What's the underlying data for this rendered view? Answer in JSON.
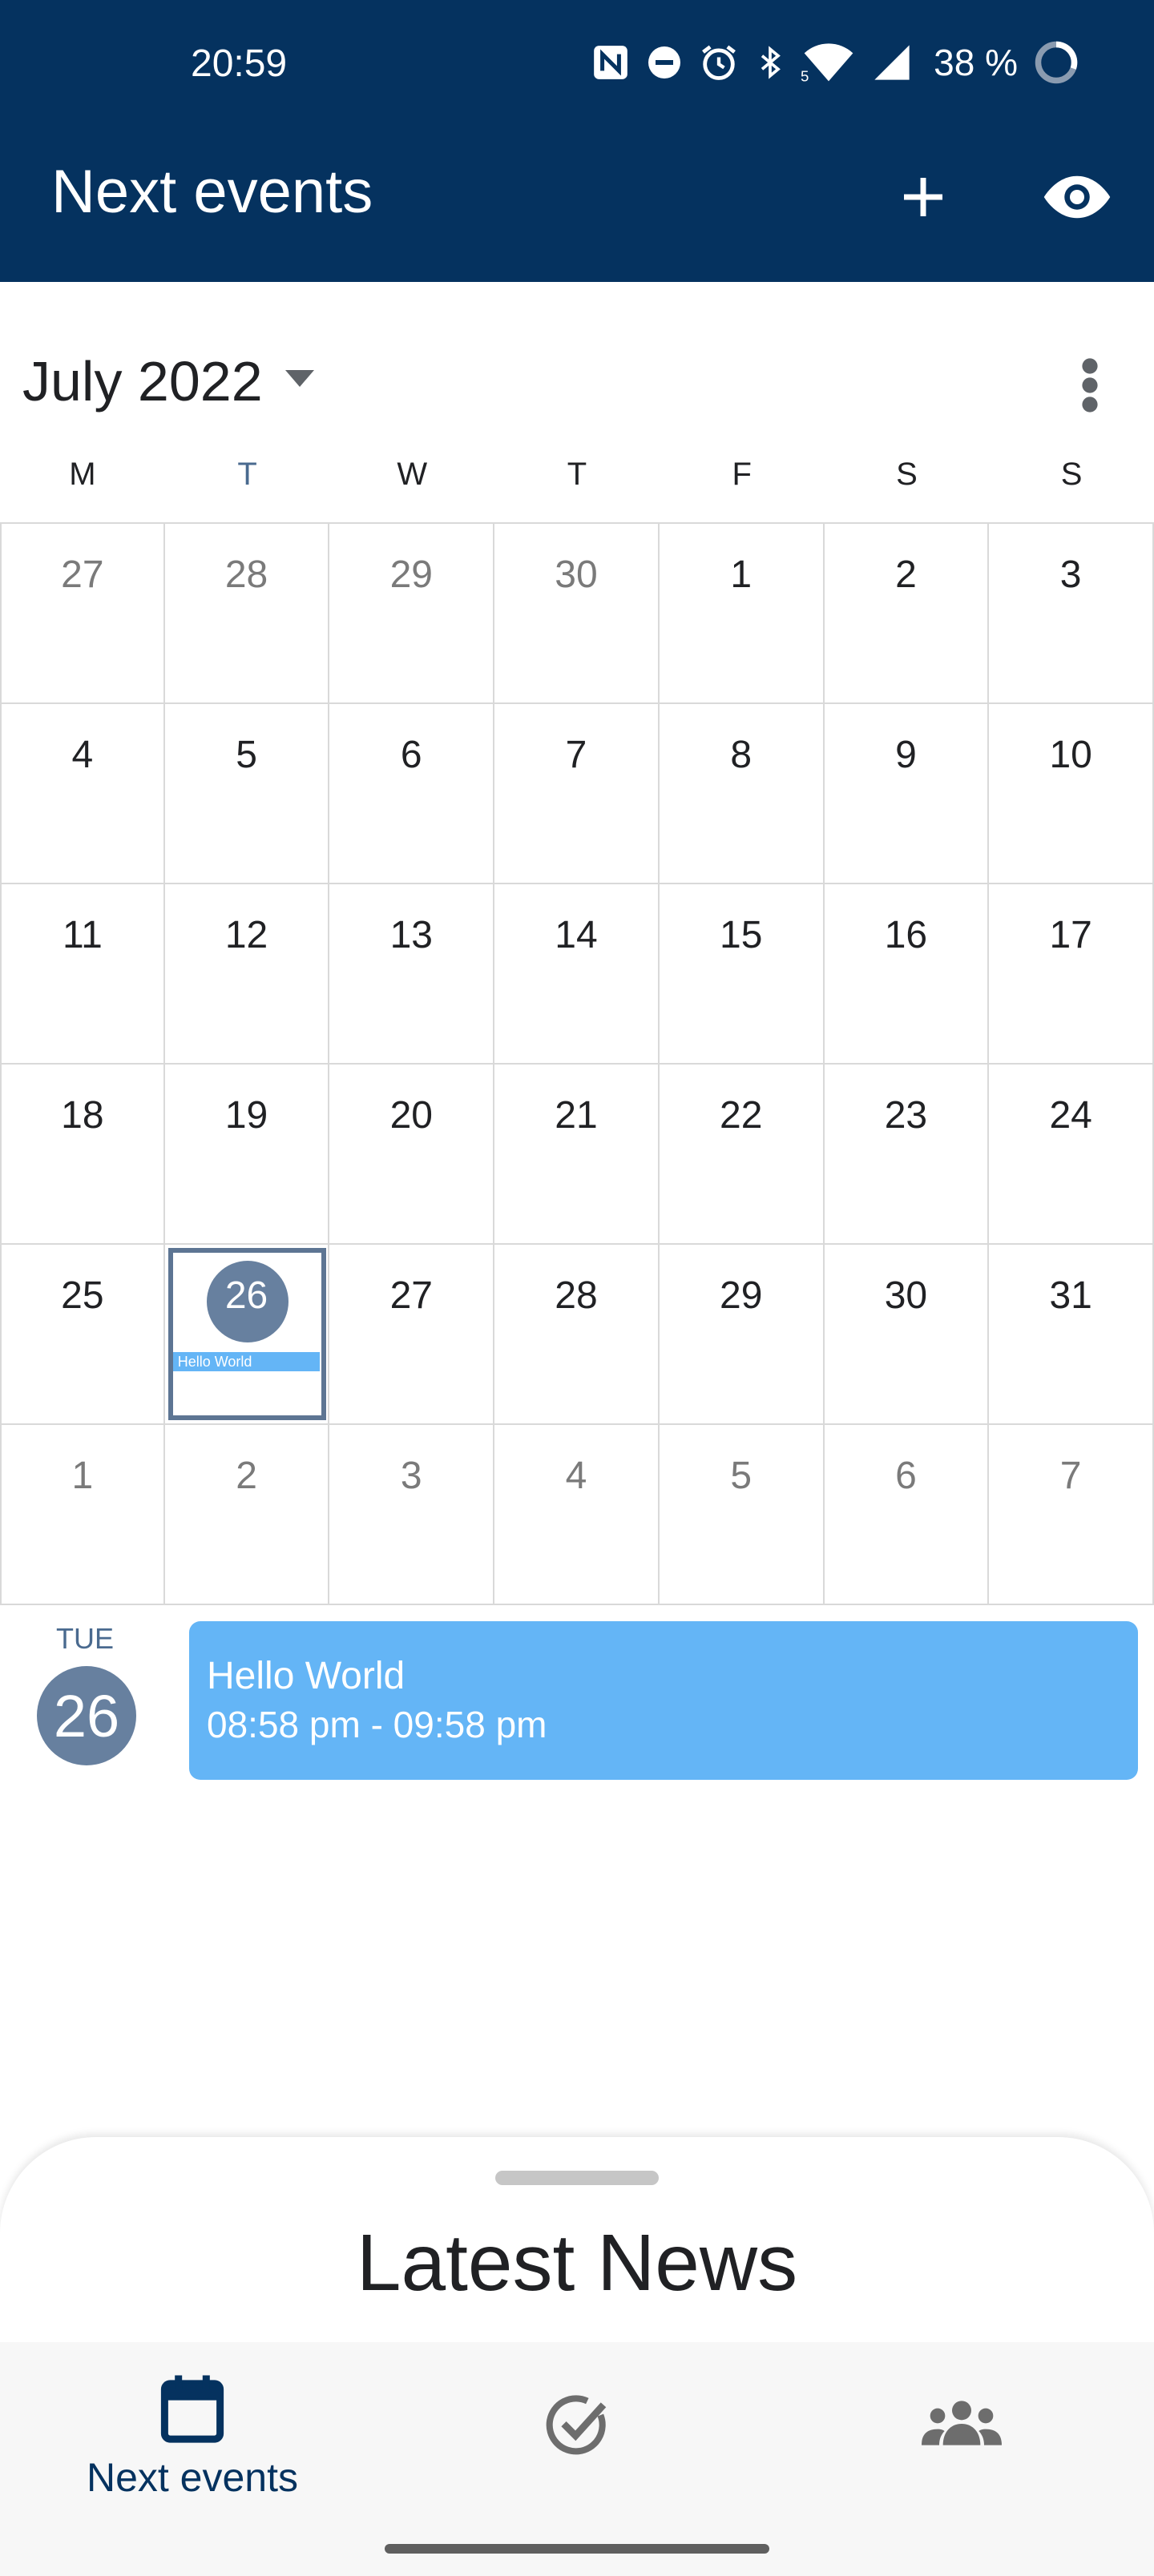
{
  "status_bar": {
    "time": "20:59",
    "battery": "38 %",
    "network_label": "5"
  },
  "app_bar": {
    "title": "Next events"
  },
  "calendar": {
    "month_label": "July 2022",
    "weekdays": [
      "M",
      "T",
      "W",
      "T",
      "F",
      "S",
      "S"
    ],
    "weeks": [
      [
        "27",
        "28",
        "29",
        "30",
        "1",
        "2",
        "3"
      ],
      [
        "4",
        "5",
        "6",
        "7",
        "8",
        "9",
        "10"
      ],
      [
        "11",
        "12",
        "13",
        "14",
        "15",
        "16",
        "17"
      ],
      [
        "18",
        "19",
        "20",
        "21",
        "22",
        "23",
        "24"
      ],
      [
        "25",
        "26",
        "27",
        "28",
        "29",
        "30",
        "31"
      ],
      [
        "1",
        "2",
        "3",
        "4",
        "5",
        "6",
        "7"
      ]
    ],
    "selected_event_label": "Hello World"
  },
  "agenda": {
    "day_of_week": "TUE",
    "day_number": "26",
    "event": {
      "title": "Hello World",
      "time": "08:58 pm - 09:58 pm"
    }
  },
  "sheet": {
    "title": "Latest News"
  },
  "bottom_nav": {
    "items": [
      {
        "label": "Next events"
      }
    ]
  },
  "colors": {
    "primary": "#05325f",
    "event_blue": "#64b5f6",
    "today_circle": "#67809f"
  }
}
